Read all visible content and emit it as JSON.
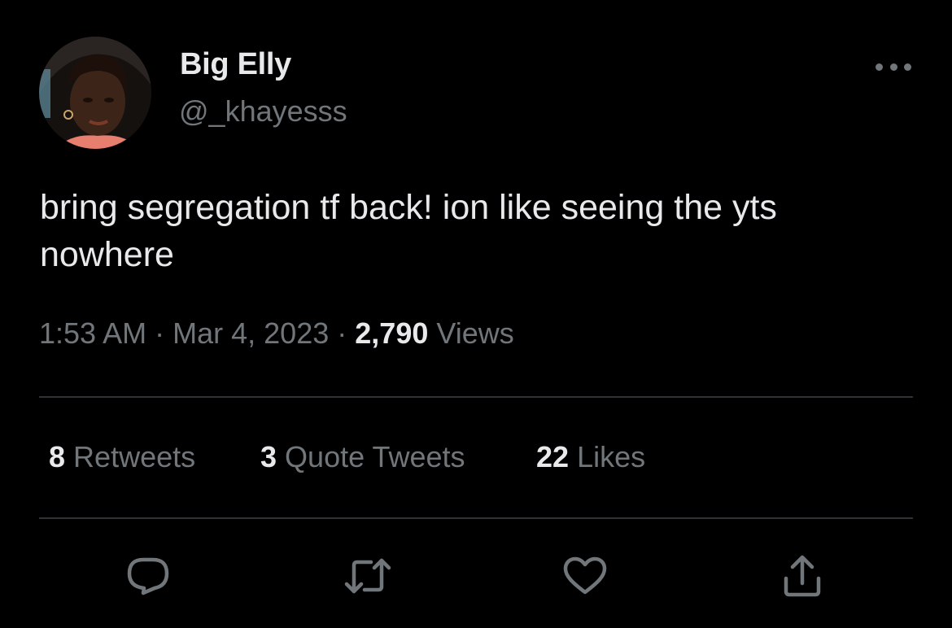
{
  "author": {
    "display_name": "Big Elly",
    "handle": "@_khayesss"
  },
  "tweet": {
    "text": "bring segregation tf back! ion like seeing the yts nowhere",
    "time": "1:53 AM",
    "date": "Mar 4, 2023",
    "separator": "·",
    "views_count": "2,790",
    "views_label": "Views"
  },
  "stats": {
    "retweets_count": "8",
    "retweets_label": "Retweets",
    "quotes_count": "3",
    "quotes_label": "Quote Tweets",
    "likes_count": "22",
    "likes_label": "Likes"
  },
  "icons": {
    "more": "more-horizontal-icon",
    "reply": "reply-icon",
    "retweet": "retweet-icon",
    "like": "heart-icon",
    "share": "share-icon"
  },
  "colors": {
    "background": "#000000",
    "primary_text": "#e7e9ea",
    "secondary_text": "#71767b",
    "divider": "#2f3336"
  }
}
